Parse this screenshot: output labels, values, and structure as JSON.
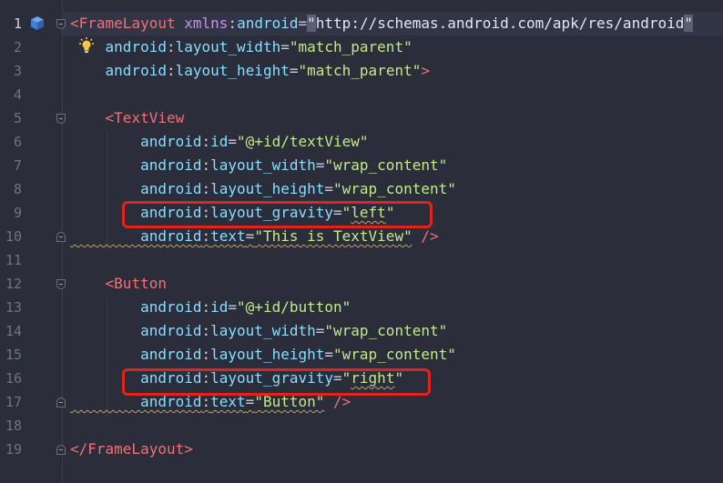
{
  "editor": {
    "lines": [
      {
        "n": "1",
        "segs": [
          {
            "t": "<",
            "c": "pun"
          },
          {
            "t": "FrameLayout",
            "c": "tag"
          },
          {
            "t": " ",
            "c": "eq"
          },
          {
            "t": "xmlns",
            "c": "ns"
          },
          {
            "t": ":",
            "c": "eq"
          },
          {
            "t": "android",
            "c": "attr"
          },
          {
            "t": "=",
            "c": "eq"
          },
          {
            "t": "\"",
            "c": "caret-bg valw"
          },
          {
            "t": "http://schemas.android.com/apk/res/android",
            "c": "valw"
          },
          {
            "t": "\"",
            "c": "caret-bg valw"
          }
        ]
      },
      {
        "n": "2",
        "segs": [
          {
            "t": "    android",
            "c": "attr"
          },
          {
            "t": ":",
            "c": "eq"
          },
          {
            "t": "layout_width",
            "c": "attr"
          },
          {
            "t": "=",
            "c": "eq"
          },
          {
            "t": "\"match_parent\"",
            "c": "val"
          }
        ]
      },
      {
        "n": "3",
        "segs": [
          {
            "t": "    android",
            "c": "attr"
          },
          {
            "t": ":",
            "c": "eq"
          },
          {
            "t": "layout_height",
            "c": "attr"
          },
          {
            "t": "=",
            "c": "eq"
          },
          {
            "t": "\"match_parent\"",
            "c": "val"
          },
          {
            "t": ">",
            "c": "pun"
          }
        ]
      },
      {
        "n": "4",
        "segs": []
      },
      {
        "n": "5",
        "segs": [
          {
            "t": "    <",
            "c": "pun"
          },
          {
            "t": "TextView",
            "c": "tag"
          }
        ]
      },
      {
        "n": "6",
        "segs": [
          {
            "t": "        android",
            "c": "attr"
          },
          {
            "t": ":",
            "c": "eq"
          },
          {
            "t": "id",
            "c": "attr"
          },
          {
            "t": "=",
            "c": "eq"
          },
          {
            "t": "\"@+id/textView\"",
            "c": "val"
          }
        ]
      },
      {
        "n": "7",
        "segs": [
          {
            "t": "        android",
            "c": "attr"
          },
          {
            "t": ":",
            "c": "eq"
          },
          {
            "t": "layout_width",
            "c": "attr"
          },
          {
            "t": "=",
            "c": "eq"
          },
          {
            "t": "\"wrap_content\"",
            "c": "val"
          }
        ]
      },
      {
        "n": "8",
        "segs": [
          {
            "t": "        android",
            "c": "attr"
          },
          {
            "t": ":",
            "c": "eq"
          },
          {
            "t": "layout_height",
            "c": "attr"
          },
          {
            "t": "=",
            "c": "eq"
          },
          {
            "t": "\"wrap_content\"",
            "c": "val"
          }
        ]
      },
      {
        "n": "9",
        "segs": [
          {
            "t": "        android",
            "c": "attr"
          },
          {
            "t": ":",
            "c": "eq"
          },
          {
            "t": "layout_gravity",
            "c": "attr"
          },
          {
            "t": "=",
            "c": "eq"
          },
          {
            "t": "\"",
            "c": "val"
          },
          {
            "t": "left",
            "c": "val wavy"
          },
          {
            "t": "\"",
            "c": "val"
          }
        ]
      },
      {
        "n": "10",
        "segs": [
          {
            "t": "        android",
            "c": "attr wavy"
          },
          {
            "t": ":",
            "c": "eq wavy"
          },
          {
            "t": "text",
            "c": "attr wavy"
          },
          {
            "t": "=",
            "c": "eq wavy"
          },
          {
            "t": "\"This is TextView\"",
            "c": "val wavy"
          },
          {
            "t": " />",
            "c": "pun"
          }
        ]
      },
      {
        "n": "11",
        "segs": []
      },
      {
        "n": "12",
        "segs": [
          {
            "t": "    <",
            "c": "pun"
          },
          {
            "t": "Button",
            "c": "tag"
          }
        ]
      },
      {
        "n": "13",
        "segs": [
          {
            "t": "        android",
            "c": "attr"
          },
          {
            "t": ":",
            "c": "eq"
          },
          {
            "t": "id",
            "c": "attr"
          },
          {
            "t": "=",
            "c": "eq"
          },
          {
            "t": "\"@+id/button\"",
            "c": "val"
          }
        ]
      },
      {
        "n": "14",
        "segs": [
          {
            "t": "        android",
            "c": "attr"
          },
          {
            "t": ":",
            "c": "eq"
          },
          {
            "t": "layout_width",
            "c": "attr"
          },
          {
            "t": "=",
            "c": "eq"
          },
          {
            "t": "\"wrap_content\"",
            "c": "val"
          }
        ]
      },
      {
        "n": "15",
        "segs": [
          {
            "t": "        android",
            "c": "attr"
          },
          {
            "t": ":",
            "c": "eq"
          },
          {
            "t": "layout_height",
            "c": "attr"
          },
          {
            "t": "=",
            "c": "eq"
          },
          {
            "t": "\"wrap_content\"",
            "c": "val"
          }
        ]
      },
      {
        "n": "16",
        "segs": [
          {
            "t": "        android",
            "c": "attr"
          },
          {
            "t": ":",
            "c": "eq"
          },
          {
            "t": "layout_gravity",
            "c": "attr"
          },
          {
            "t": "=",
            "c": "eq"
          },
          {
            "t": "\"",
            "c": "val"
          },
          {
            "t": "right",
            "c": "val wavy"
          },
          {
            "t": "\"",
            "c": "val"
          }
        ]
      },
      {
        "n": "17",
        "segs": [
          {
            "t": "        android",
            "c": "attr wavy"
          },
          {
            "t": ":",
            "c": "eq wavy"
          },
          {
            "t": "text",
            "c": "attr wavy"
          },
          {
            "t": "=",
            "c": "eq wavy"
          },
          {
            "t": "\"Button\"",
            "c": "val wavy"
          },
          {
            "t": " />",
            "c": "pun"
          }
        ]
      },
      {
        "n": "18",
        "segs": []
      },
      {
        "n": "19",
        "segs": [
          {
            "t": "</",
            "c": "pun"
          },
          {
            "t": "FrameLayout",
            "c": "tag"
          },
          {
            "t": ">",
            "c": "pun"
          }
        ]
      }
    ],
    "icons": {
      "gutter_line1": "cube-icon",
      "gutter_line2": "lightbulb-icon"
    },
    "colors": {
      "background": "#2b2d3a",
      "highlight_box": "#e0241b",
      "tag": "#f07178",
      "attribute": "#89ddff",
      "string": "#c3e88d"
    }
  }
}
